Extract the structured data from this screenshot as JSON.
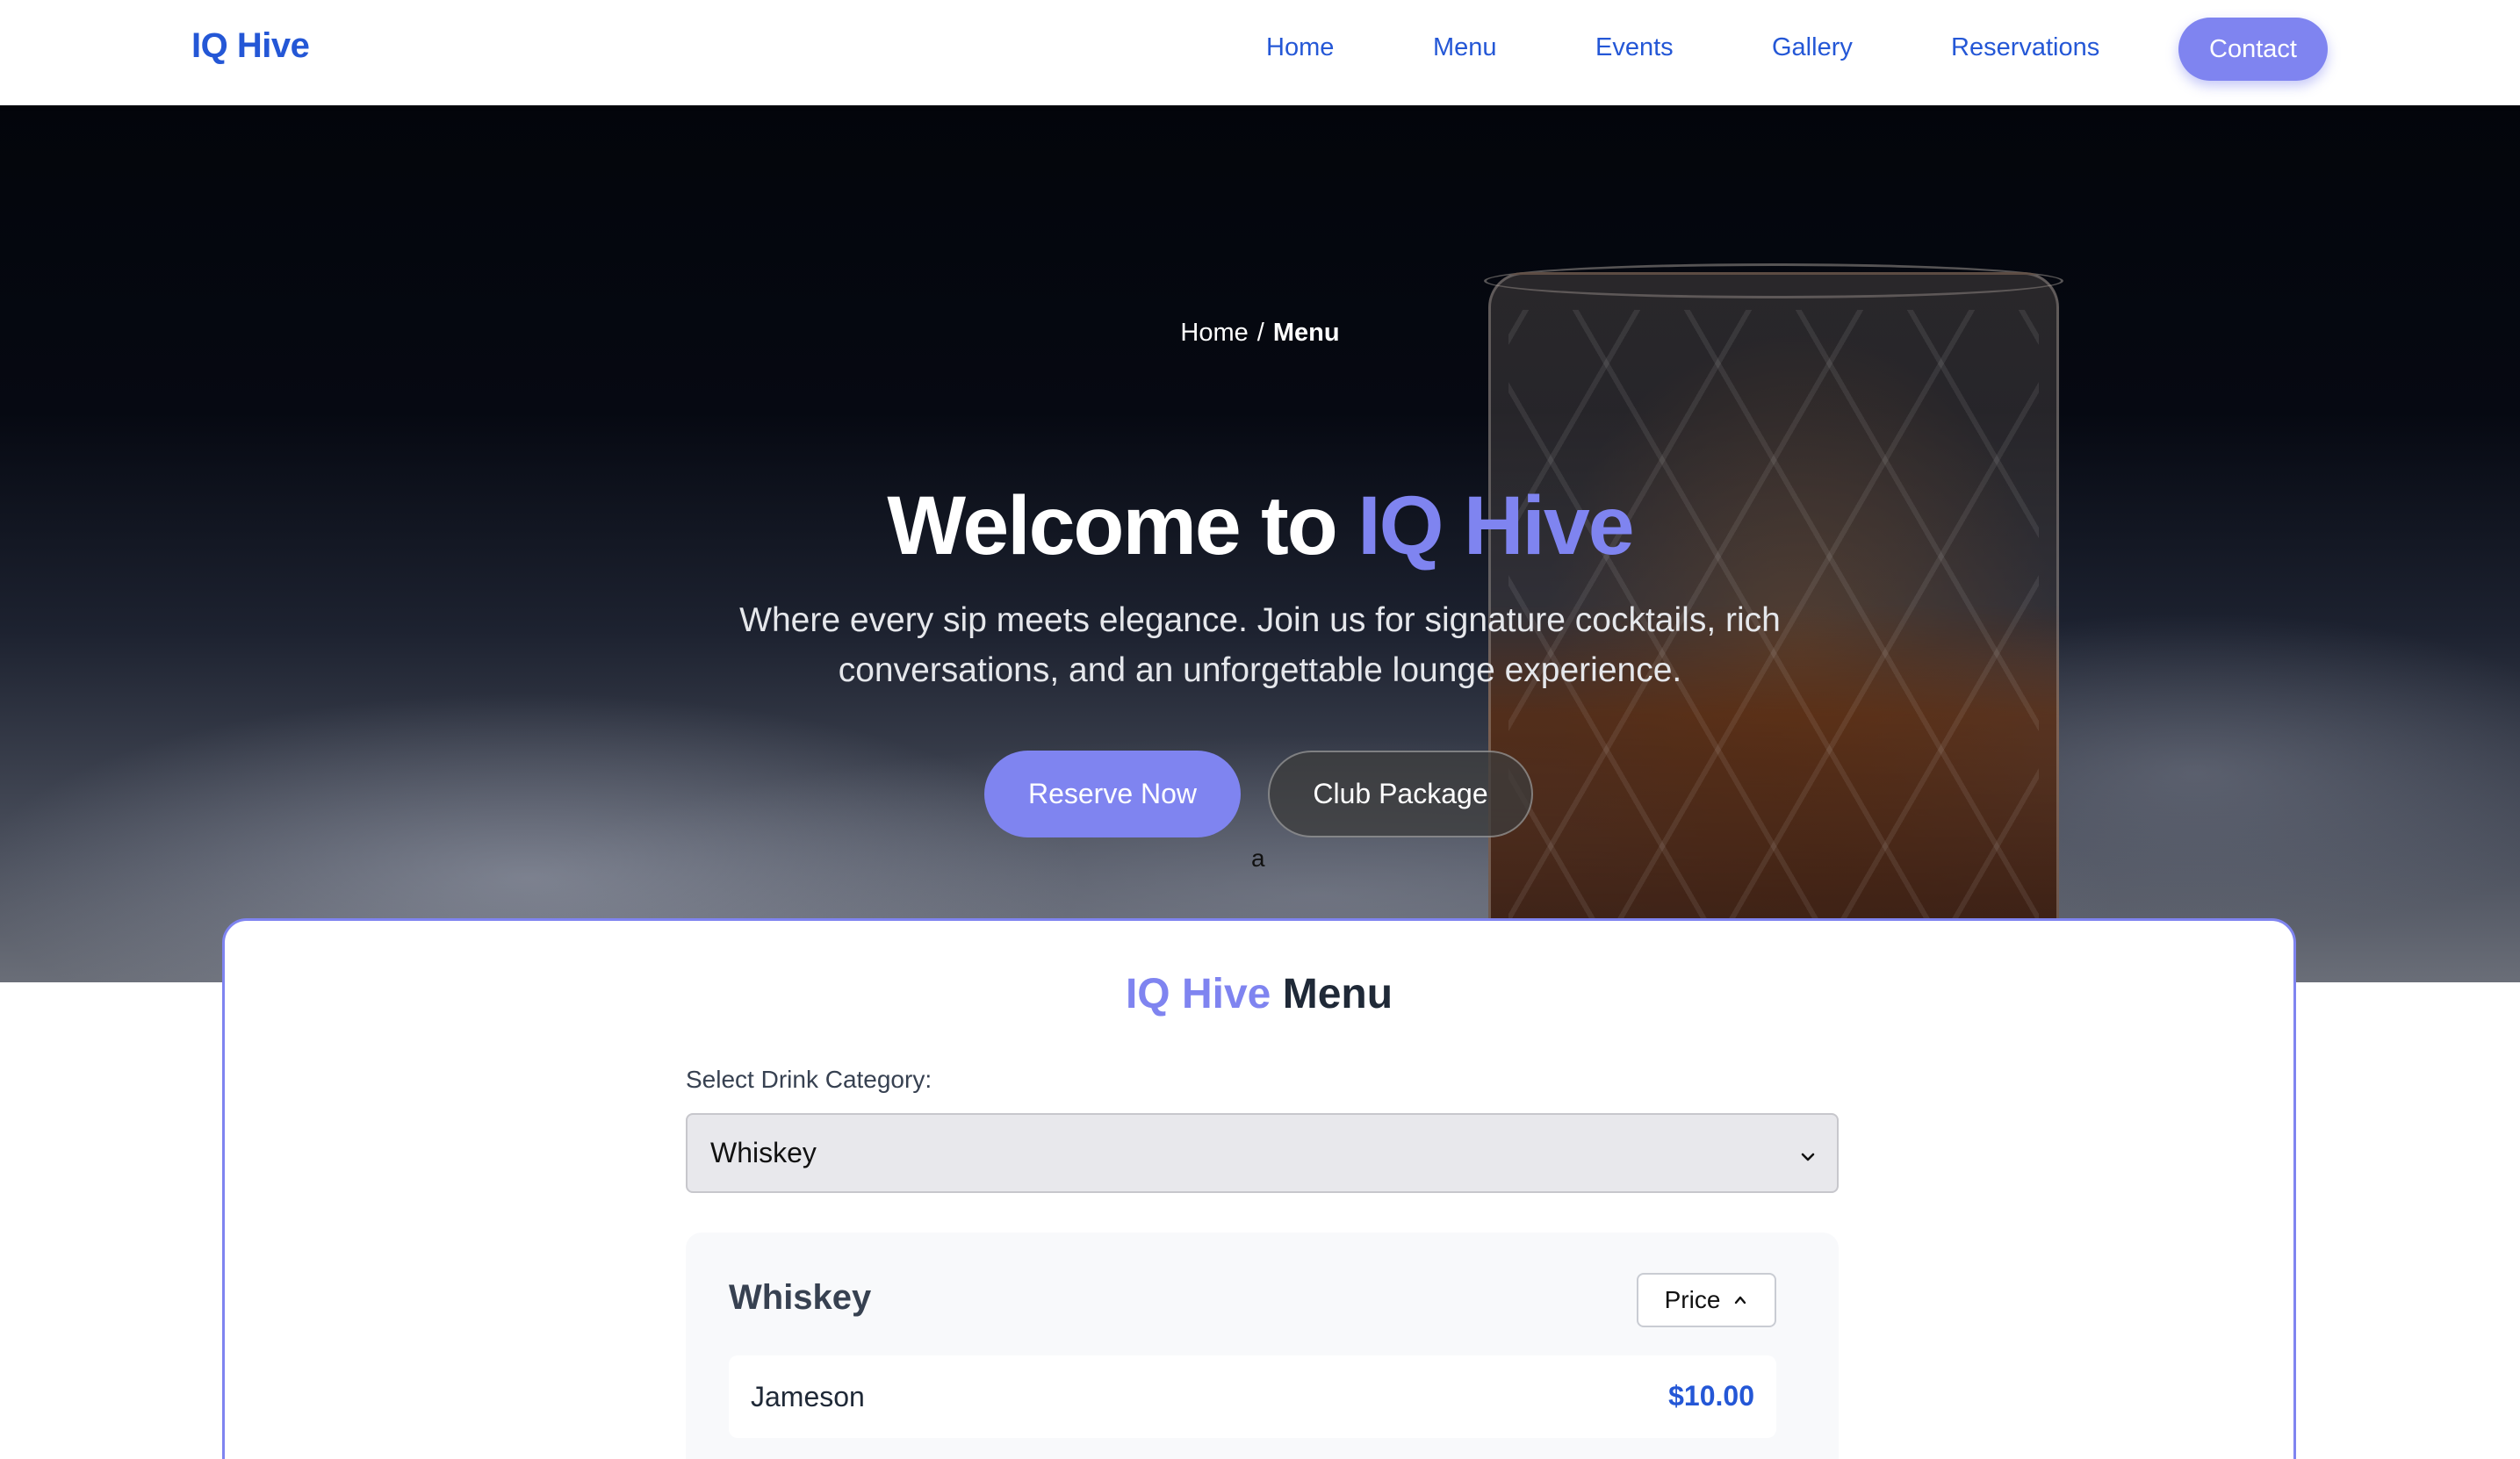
{
  "brand": "IQ Hive",
  "nav": {
    "items": [
      {
        "label": "Home"
      },
      {
        "label": "Menu"
      },
      {
        "label": "Events"
      },
      {
        "label": "Gallery"
      },
      {
        "label": "Reservations"
      }
    ],
    "contact_label": "Contact"
  },
  "hero": {
    "breadcrumb": {
      "home": "Home",
      "separator": "/",
      "current": "Menu"
    },
    "title_prefix": "Welcome to",
    "title_accent": "IQ Hive",
    "subtitle": "Where every sip meets elegance. Join us for signature cocktails, rich conversations, and an unforgettable lounge experience.",
    "primary_button": "Reserve Now",
    "secondary_button": "Club Package",
    "stray_text": "a"
  },
  "menu_card": {
    "title_accent": "IQ Hive",
    "title_rest": "Menu",
    "select_label": "Select Drink Category:",
    "selected_category": "Whiskey",
    "category_heading": "Whiskey",
    "sort_label": "Price",
    "items": [
      {
        "name": "Jameson",
        "price": "$10.00"
      }
    ]
  },
  "colors": {
    "accent": "#7f84f0",
    "link_blue": "#2457d6",
    "price_blue": "#2457d6"
  }
}
